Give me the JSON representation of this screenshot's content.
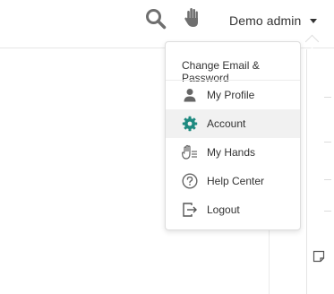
{
  "header": {
    "user_name": "Demo admin"
  },
  "dropdown": {
    "header": "Change Email & Password",
    "items": [
      {
        "label": "My Profile",
        "icon": "person-icon"
      },
      {
        "label": "Account",
        "icon": "gear-icon",
        "active": true,
        "icon_color": "#1f8a80"
      },
      {
        "label": "My Hands",
        "icon": "hand-list-icon"
      },
      {
        "label": "Help Center",
        "icon": "help-circle-icon"
      },
      {
        "label": "Logout",
        "icon": "logout-icon"
      }
    ]
  },
  "colors": {
    "accent_teal": "#1f8a80",
    "active_bg": "#f1f1f1",
    "icon_gray": "#666666"
  }
}
